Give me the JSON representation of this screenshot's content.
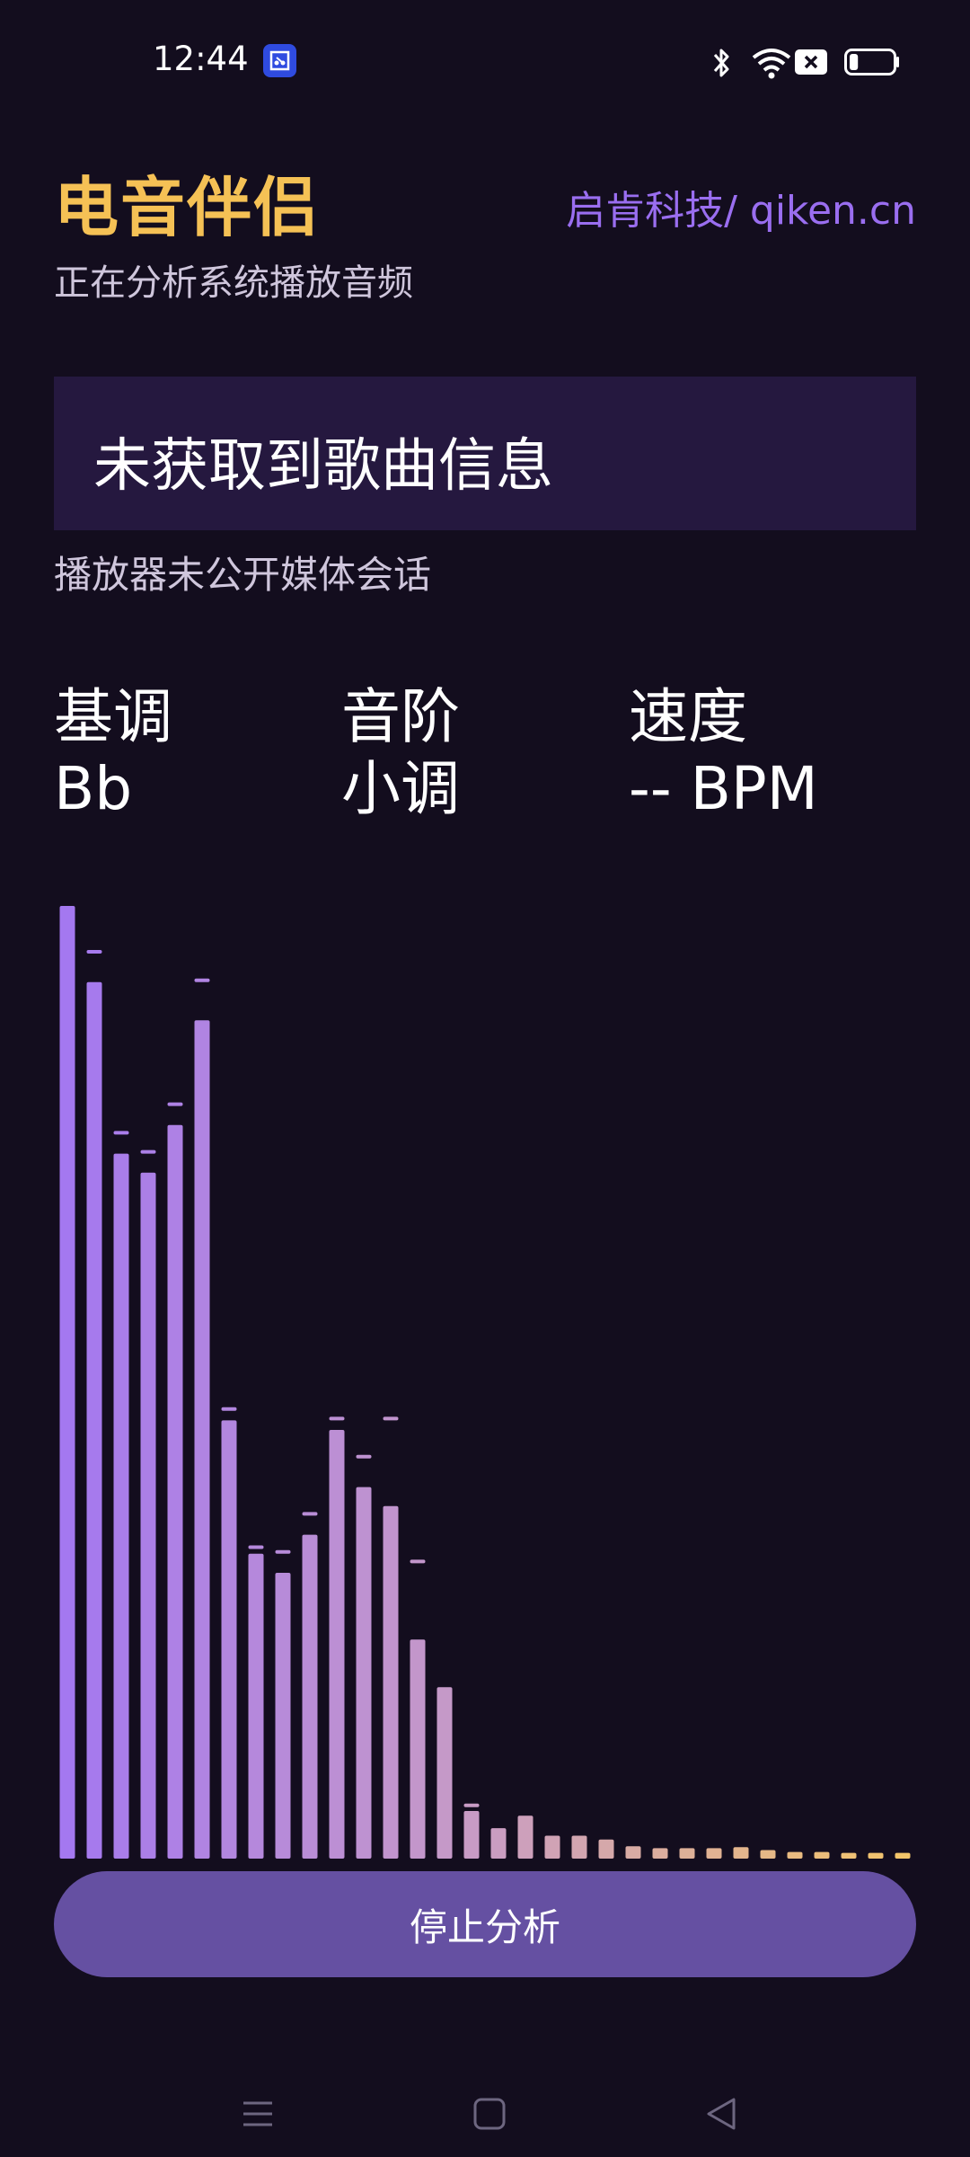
{
  "status_bar": {
    "time": "12:44",
    "app_icon": "scan-icon",
    "icons": [
      "bluetooth-icon",
      "wifi-icon",
      "sim-off-icon",
      "battery-icon"
    ],
    "battery_level": 0.2
  },
  "header": {
    "title": "电音伴侣",
    "company": "启肯科技/ qiken.cn",
    "subtitle": "正在分析系统播放音频"
  },
  "song": {
    "title": "未获取到歌曲信息",
    "note": "播放器未公开媒体会话"
  },
  "info": {
    "key_label": "基调",
    "key_value": "Bb",
    "scale_label": "音阶",
    "scale_value": "小调",
    "tempo_label": "速度",
    "tempo_value": "-- BPM"
  },
  "chart_data": {
    "type": "bar",
    "values": [
      1.0,
      0.92,
      0.74,
      0.72,
      0.77,
      0.88,
      0.46,
      0.32,
      0.3,
      0.34,
      0.45,
      0.39,
      0.37,
      0.23,
      0.18,
      0.05,
      0.032,
      0.045,
      0.024,
      0.024,
      0.02,
      0.013,
      0.011,
      0.011,
      0.011,
      0.012,
      0.009,
      0.007,
      0.007,
      0.006,
      0.006,
      0.006
    ],
    "peaks": [
      null,
      0.95,
      0.76,
      0.74,
      0.79,
      0.92,
      0.47,
      0.325,
      0.32,
      0.36,
      0.46,
      0.42,
      0.46,
      0.31,
      null,
      0.054,
      null,
      null,
      null,
      null,
      null,
      null,
      null,
      null,
      null,
      null,
      null,
      null,
      null,
      null,
      null,
      null
    ],
    "colors": {
      "start": "#a478f0",
      "mid": "#c99cc4",
      "end": "#f3c56a"
    }
  },
  "controls": {
    "stop_label": "停止分析"
  },
  "nav": {
    "items": [
      "menu-icon",
      "home-icon",
      "back-icon"
    ]
  }
}
